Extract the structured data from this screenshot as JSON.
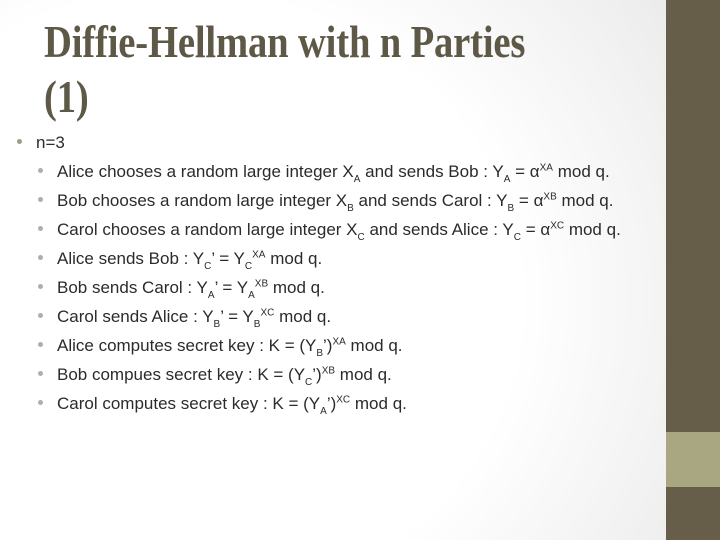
{
  "slide": {
    "title_line1": "Diffie-Hellman with n Parties",
    "title_line2": "(1)",
    "accent_colors": {
      "title": "#5e5847",
      "side_bar": "#665e48",
      "side_band": "#a9a782"
    }
  },
  "bullets": {
    "top": "n=3",
    "items": [
      {
        "pre": "Alice chooses a random large integer X",
        "sub1": "A",
        "mid": " and sends Bob : Y",
        "sub2": "A",
        "eq": " = α",
        "sup": "XA",
        "post": " mod q."
      },
      {
        "pre": "Bob chooses a random large integer X",
        "sub1": "B",
        "mid": " and sends Carol : Y",
        "sub2": "B",
        "eq": " = α",
        "sup": "XB",
        "post": " mod q."
      },
      {
        "pre": "Carol chooses a random large integer X",
        "sub1": "C",
        "mid": " and sends Alice : Y",
        "sub2": "C",
        "eq": " = α",
        "sup": "XC",
        "post": " mod q."
      },
      {
        "pre": "Alice sends Bob : Y",
        "sub1": "C",
        "mid": "’ = Y",
        "sub2": "C",
        "sup": "XA",
        "post": " mod q."
      },
      {
        "pre": "Bob sends Carol : Y",
        "sub1": "A",
        "mid": "’ = Y",
        "sub2": "A",
        "sup": "XB",
        "post": " mod q."
      },
      {
        "pre": "Carol sends Alice : Y",
        "sub1": "B",
        "mid": "’ = Y",
        "sub2": "B",
        "sup": "XC",
        "post": " mod q."
      },
      {
        "pre": "Alice computes secret key : K = (Y",
        "sub1": "B",
        "mid": "’)",
        "sup": "XA",
        "post": " mod q."
      },
      {
        "pre": "Bob compues secret key : K = (Y",
        "sub1": "C",
        "mid": "’)",
        "sup": "XB",
        "post": " mod q."
      },
      {
        "pre": "Carol computes secret key : K = (Y",
        "sub1": "A",
        "mid": "’)",
        "sup": "XC",
        "post": " mod q."
      }
    ]
  }
}
